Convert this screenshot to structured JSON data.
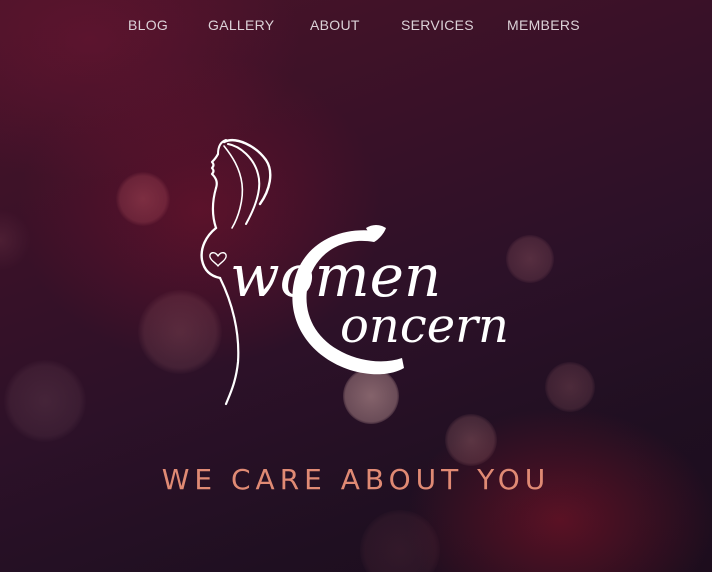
{
  "nav": {
    "items": [
      {
        "label": "BLOG"
      },
      {
        "label": "GALLERY"
      },
      {
        "label": "ABOUT"
      },
      {
        "label": "SERVICES"
      },
      {
        "label": "MEMBERS"
      }
    ]
  },
  "logo": {
    "word_top": "women",
    "word_bottom": "oncern",
    "initial": "C"
  },
  "hero": {
    "tagline": "WE CARE ABOUT YOU"
  },
  "colors": {
    "background_top": "#4a1429",
    "background_bottom": "#1d0d1d",
    "tagline": "#e08a74",
    "nav_text": "#dcd2d8",
    "logo": "#ffffff"
  }
}
